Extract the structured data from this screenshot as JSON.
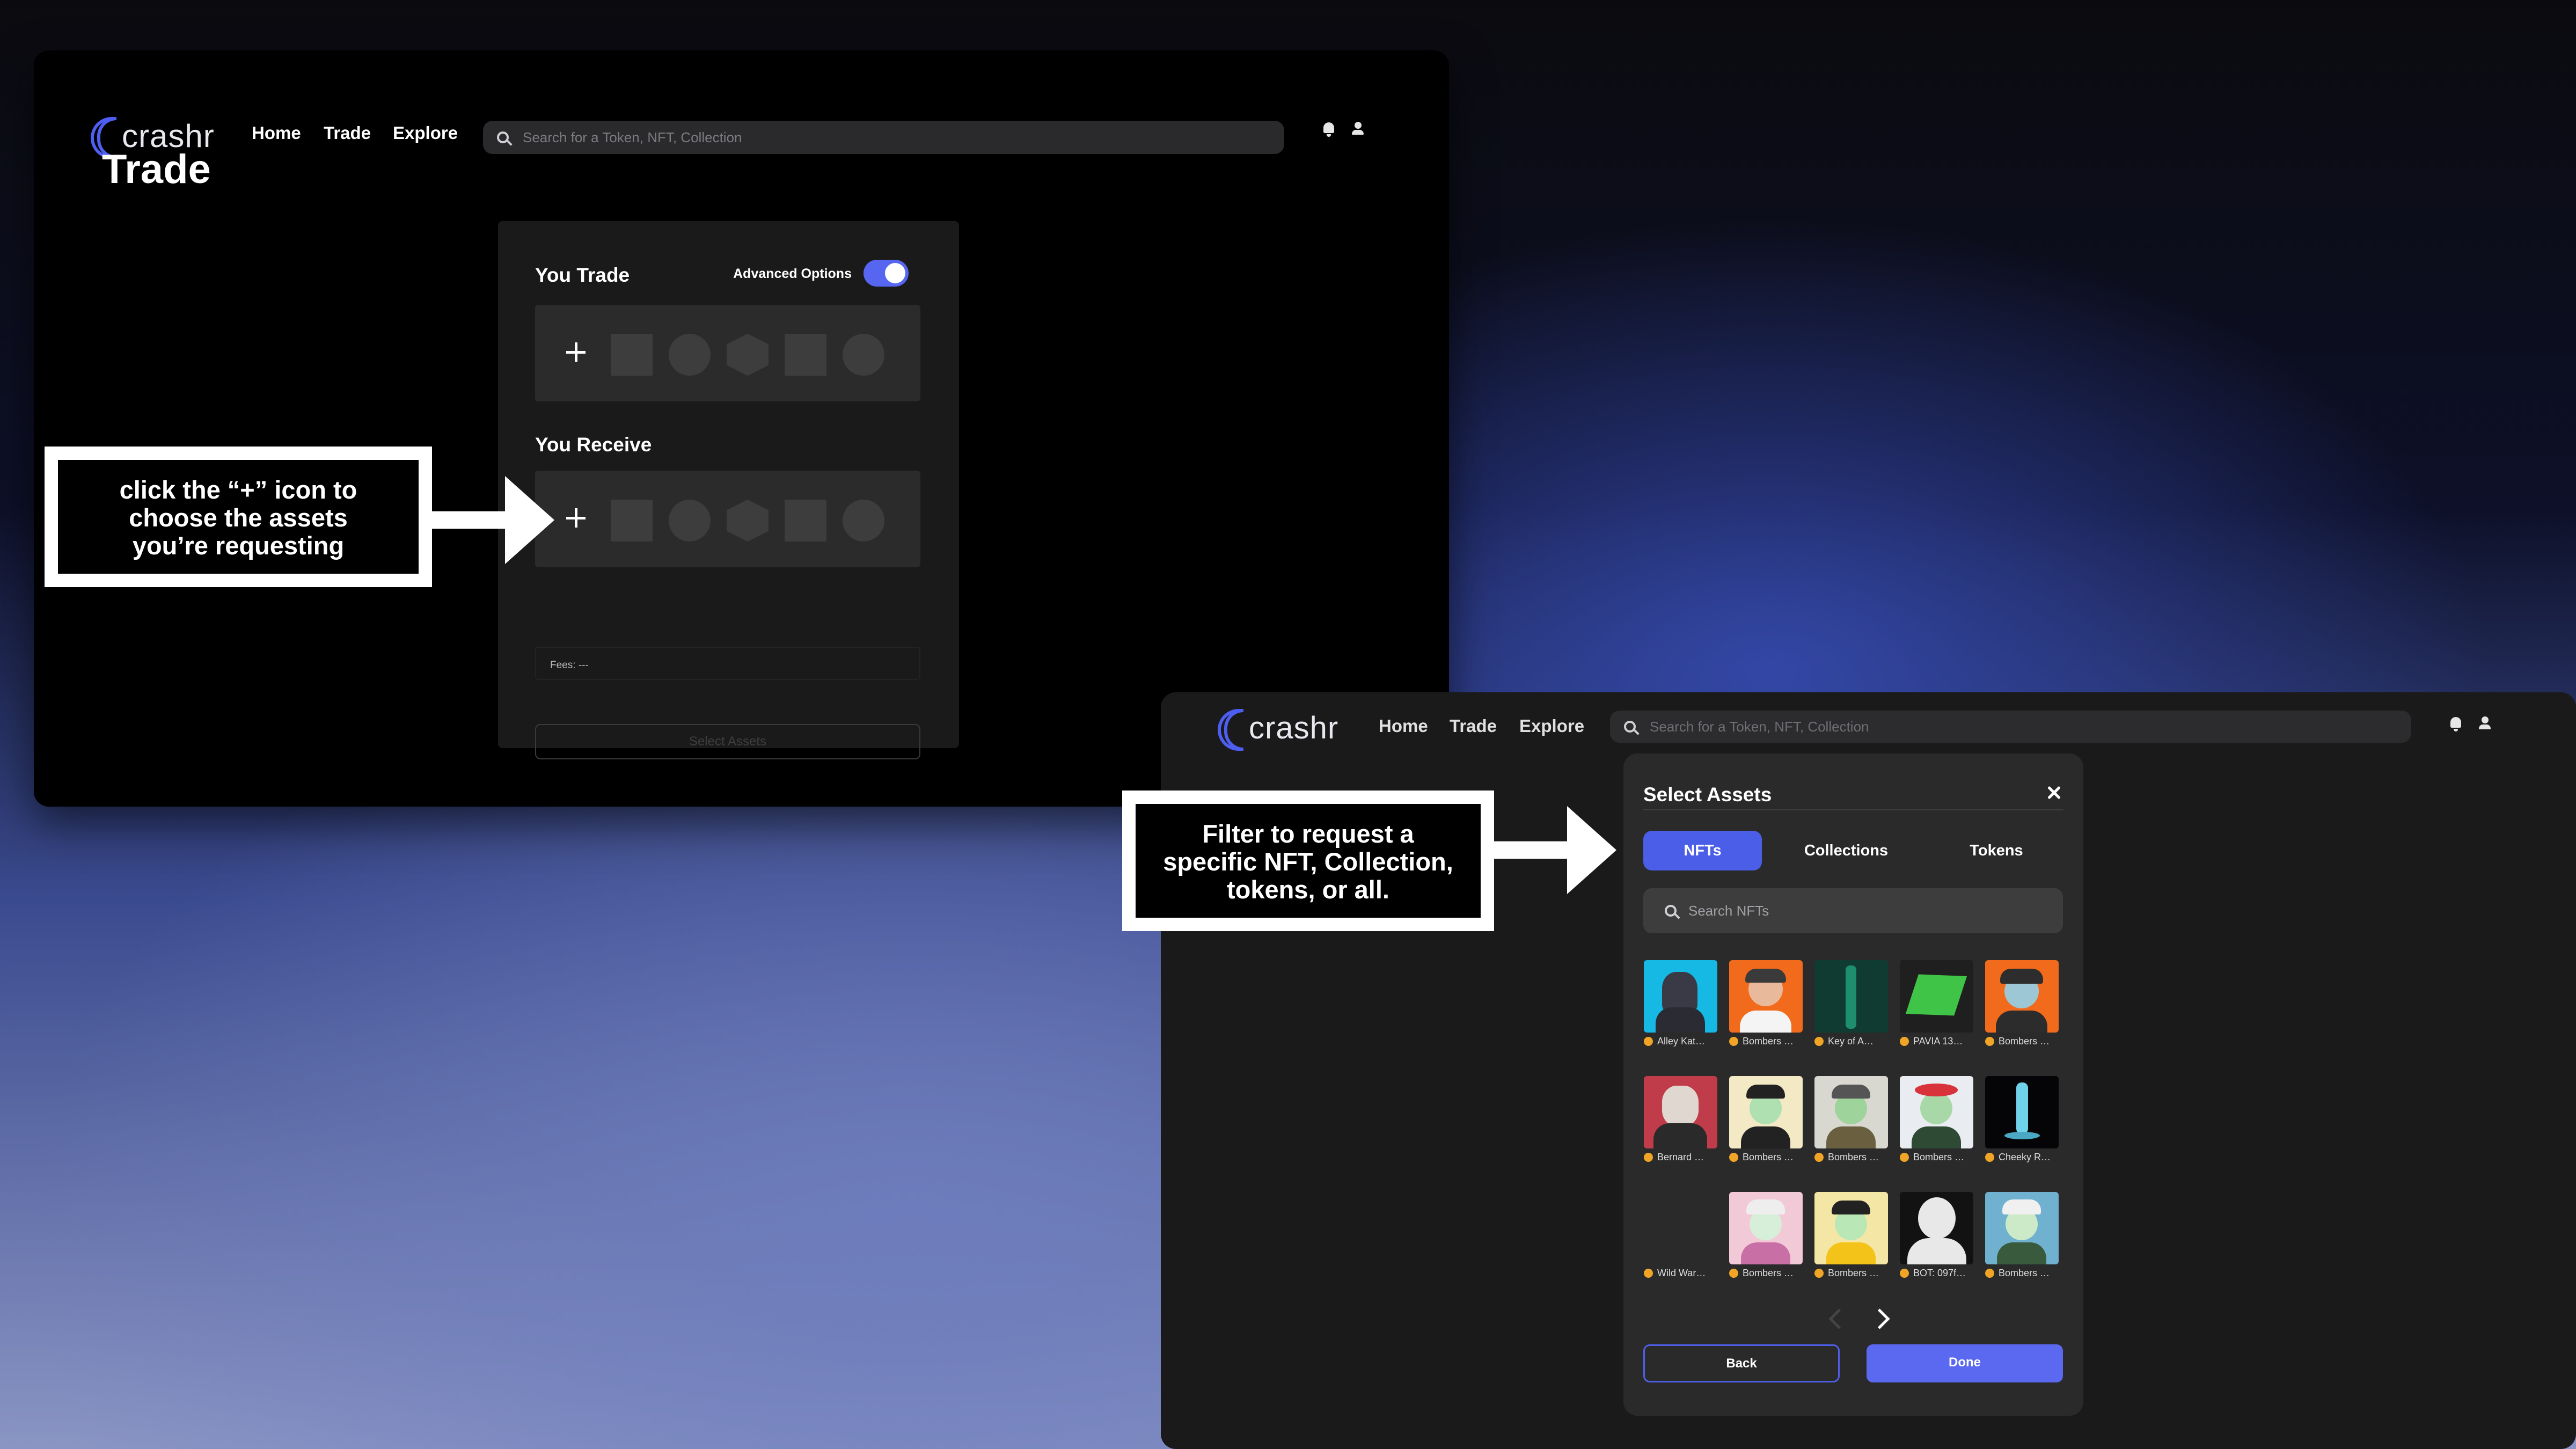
{
  "app": {
    "name": "crashr"
  },
  "nav": {
    "links": [
      "Home",
      "Trade",
      "Explore"
    ],
    "search_placeholder": "Search for a Token, NFT, Collection",
    "icons": [
      "bell-icon",
      "user-icon"
    ]
  },
  "trade_page": {
    "title": "Trade",
    "you_trade_label": "You Trade",
    "advanced_options_label": "Advanced Options",
    "advanced_options_on": true,
    "you_receive_label": "You Receive",
    "fees_label": "Fees:",
    "fees_value": "---",
    "select_assets_button": "Select Assets"
  },
  "callouts": {
    "plus_hint": [
      "click the “+” icon to",
      "choose the assets",
      "you’re requesting"
    ],
    "filter_hint": [
      "Filter to request a",
      "specific NFT,  Collection,",
      "tokens, or all."
    ]
  },
  "modal": {
    "title": "Select Assets",
    "tabs": [
      "NFTs",
      "Collections",
      "Tokens"
    ],
    "active_tab": "NFTs",
    "search_placeholder": "Search NFTs",
    "nfts": [
      "Alley Kat…",
      "Bombers …",
      "Key of A…",
      "PAVIA 13…",
      "Bombers …",
      "Bernard …",
      "Bombers …",
      "Bombers …",
      "Bombers …",
      "Cheeky R…",
      "Wild War…",
      "Bombers …",
      "Bombers …",
      "BOT: 097f…",
      "Bombers …"
    ],
    "back_button": "Back",
    "done_button": "Done"
  },
  "colors": {
    "accent": "#5766f0",
    "verified_badge": "#f0a527"
  }
}
